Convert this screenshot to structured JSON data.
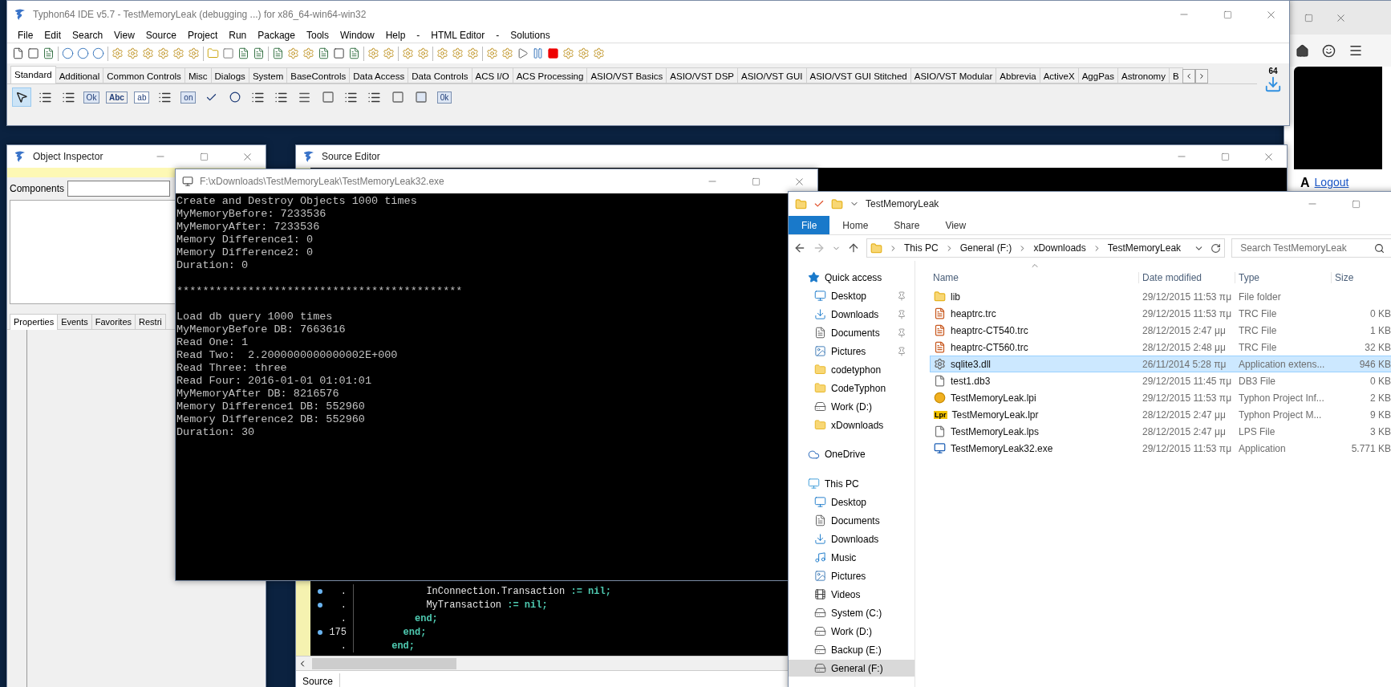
{
  "ide": {
    "title": "Typhon64 IDE v5.7 - TestMemoryLeak (debugging ...) for x86_64-win64-win32",
    "menu": [
      "File",
      "Edit",
      "Search",
      "View",
      "Source",
      "Project",
      "Run",
      "Package",
      "Tools",
      "Window",
      "Help",
      "-",
      "HTML Editor",
      "-",
      "Solutions"
    ],
    "palette_tabs": [
      {
        "label": "Standard",
        "selected": true
      },
      {
        "label": "Additional",
        "selected": false
      },
      {
        "label": "Common Controls",
        "selected": false
      },
      {
        "label": "Misc",
        "selected": false
      },
      {
        "label": "Dialogs",
        "selected": false
      },
      {
        "label": "System",
        "selected": false
      },
      {
        "label": "BaseControls",
        "selected": false
      },
      {
        "label": "Data Access",
        "selected": false
      },
      {
        "label": "Data Controls",
        "selected": false
      },
      {
        "label": "ACS I/O",
        "selected": false
      },
      {
        "label": "ACS Processing",
        "selected": false
      },
      {
        "label": "ASIO/VST Basics",
        "selected": false
      },
      {
        "label": "ASIO/VST DSP",
        "selected": false
      },
      {
        "label": "ASIO/VST GUI",
        "selected": false
      },
      {
        "label": "ASIO/VST GUI Stitched",
        "selected": false
      },
      {
        "label": "ASIO/VST Modular",
        "selected": false
      },
      {
        "label": "Abbrevia",
        "selected": false
      },
      {
        "label": "ActiveX",
        "selected": false
      },
      {
        "label": "AggPas",
        "selected": false
      },
      {
        "label": "Astronomy",
        "selected": false
      },
      {
        "label": "B",
        "selected": false
      }
    ],
    "platform_badge": "64",
    "components": [
      {
        "kind": "pointer",
        "selected": true
      },
      {
        "kind": "menu",
        "selected": false
      },
      {
        "kind": "popup",
        "selected": false
      },
      {
        "kind": "button",
        "text": "Ok",
        "selected": false
      },
      {
        "kind": "label",
        "text": "Abc",
        "selected": false
      },
      {
        "kind": "edit",
        "text": "ab",
        "selected": false
      },
      {
        "kind": "memo",
        "selected": false
      },
      {
        "kind": "button",
        "text": "on",
        "selected": false
      },
      {
        "kind": "checkbox",
        "selected": false
      },
      {
        "kind": "radio",
        "selected": false
      },
      {
        "kind": "list",
        "selected": false
      },
      {
        "kind": "list",
        "selected": false
      },
      {
        "kind": "scrollbar",
        "selected": false
      },
      {
        "kind": "panel",
        "selected": false
      },
      {
        "kind": "list",
        "selected": false
      },
      {
        "kind": "checklist",
        "selected": false
      },
      {
        "kind": "panel",
        "selected": false
      },
      {
        "kind": "frame",
        "selected": false
      },
      {
        "kind": "button",
        "text": "0k",
        "selected": false
      }
    ]
  },
  "browser": {
    "letter": "A",
    "link": "Logout"
  },
  "object_inspector": {
    "title": "Object Inspector",
    "components_label": "Components",
    "tabs": [
      {
        "label": "Properties",
        "selected": true
      },
      {
        "label": "Events",
        "selected": false
      },
      {
        "label": "Favorites",
        "selected": false
      },
      {
        "label": "Restri",
        "selected": false
      }
    ]
  },
  "source_editor": {
    "title": "Source Editor",
    "code_lines": [
      {
        "gutter": ".",
        "breakpoint": true,
        "parts": [
          {
            "text": "            InConnection.Transaction",
            "keyword": false
          },
          {
            "text": " := nil;",
            "keyword": true
          }
        ]
      },
      {
        "gutter": ".",
        "breakpoint": true,
        "parts": [
          {
            "text": "            MyTransaction",
            "keyword": false
          },
          {
            "text": " := nil;",
            "keyword": true
          }
        ]
      },
      {
        "gutter": ".",
        "breakpoint": false,
        "parts": [
          {
            "text": "          end;",
            "keyword": true
          }
        ]
      },
      {
        "gutter": "175",
        "breakpoint": true,
        "parts": [
          {
            "text": "        end;",
            "keyword": true
          }
        ]
      },
      {
        "gutter": ".",
        "breakpoint": false,
        "parts": [
          {
            "text": "      end;",
            "keyword": true
          }
        ]
      }
    ],
    "bottom_tab": "Source"
  },
  "console": {
    "title": "F:\\xDownloads\\TestMemoryLeak\\TestMemoryLeak32.exe",
    "sections": [
      {
        "lines": [
          "Create and Destroy Objects 1000 times",
          "MyMemoryBefore: 7233536",
          "MyMemoryAfter: 7233536",
          "Memory Difference1: 0",
          "Memory Difference2: 0",
          "Duration: 0"
        ]
      },
      {
        "lines": [
          "********************************************"
        ]
      },
      {
        "lines": [
          "Load db query 1000 times",
          "MyMemoryBefore DB: 7663616",
          "Read One: 1",
          "Read Two:  2.2000000000000002E+000",
          "Read Three: three",
          "Read Four: 2016-01-01 01:01:01",
          "MyMemoryAfter DB: 8216576",
          "Memory Difference1 DB: 552960",
          "Memory Difference2 DB: 552960",
          "Duration: 30"
        ]
      }
    ]
  },
  "explorer": {
    "title": "TestMemoryLeak",
    "ribbon_tabs": [
      {
        "label": "File",
        "selected": true
      },
      {
        "label": "Home",
        "selected": false
      },
      {
        "label": "Share",
        "selected": false
      },
      {
        "label": "View",
        "selected": false
      }
    ],
    "breadcrumb": [
      "This PC",
      "General (F:)",
      "xDownloads",
      "TestMemoryLeak"
    ],
    "search": {
      "placeholder": "Search TestMemoryLeak"
    },
    "nav": [
      {
        "label": "Quick access",
        "kind": "star",
        "selected": false,
        "children": [
          {
            "label": "Desktop",
            "kind": "desktop",
            "pinned": true,
            "selected": false
          },
          {
            "label": "Downloads",
            "kind": "download",
            "pinned": true,
            "selected": false
          },
          {
            "label": "Documents",
            "kind": "document",
            "pinned": true,
            "selected": false
          },
          {
            "label": "Pictures",
            "kind": "picture",
            "pinned": true,
            "selected": false
          },
          {
            "label": "codetyphon",
            "kind": "folder",
            "pinned": false,
            "selected": false
          },
          {
            "label": "CodeTyphon",
            "kind": "folder",
            "pinned": false,
            "selected": false
          },
          {
            "label": "Work (D:)",
            "kind": "drive",
            "pinned": false,
            "selected": false
          },
          {
            "label": "xDownloads",
            "kind": "folder",
            "pinned": false,
            "selected": false
          }
        ]
      },
      {
        "label": "OneDrive",
        "kind": "cloud",
        "selected": false
      },
      {
        "label": "This PC",
        "kind": "pc",
        "selected": false,
        "children": [
          {
            "label": "Desktop",
            "kind": "desktop",
            "selected": false
          },
          {
            "label": "Documents",
            "kind": "document",
            "selected": false
          },
          {
            "label": "Downloads",
            "kind": "download",
            "selected": false
          },
          {
            "label": "Music",
            "kind": "music",
            "selected": false
          },
          {
            "label": "Pictures",
            "kind": "picture",
            "selected": false
          },
          {
            "label": "Videos",
            "kind": "video",
            "selected": false
          },
          {
            "label": "System (C:)",
            "kind": "drive",
            "selected": false
          },
          {
            "label": "Work (D:)",
            "kind": "drive",
            "selected": false
          },
          {
            "label": "Backup (E:)",
            "kind": "drive",
            "selected": false
          },
          {
            "label": "General (F:)",
            "kind": "drive",
            "selected": true
          }
        ]
      }
    ],
    "columns": [
      "Name",
      "Date modified",
      "Type",
      "Size"
    ],
    "rows": [
      {
        "name": "lib",
        "date": "29/12/2015 11:53 πμ",
        "type": "File folder",
        "kind": "folder",
        "selected": false
      },
      {
        "name": "heaptrc.trc",
        "date": "29/12/2015 11:53 πμ",
        "type": "TRC File",
        "size": "0 KB",
        "kind": "trc",
        "selected": false
      },
      {
        "name": "heaptrc-CT540.trc",
        "date": "28/12/2015 2:47 μμ",
        "type": "TRC File",
        "size": "1 KB",
        "kind": "trc",
        "selected": false
      },
      {
        "name": "heaptrc-CT560.trc",
        "date": "28/12/2015 2:48 μμ",
        "type": "TRC File",
        "size": "32 KB",
        "kind": "trc",
        "selected": false
      },
      {
        "name": "sqlite3.dll",
        "date": "26/11/2014 5:28 πμ",
        "type": "Application extens...",
        "size": "946 KB",
        "kind": "dll",
        "selected": true
      },
      {
        "name": "test1.db3",
        "date": "29/12/2015 11:45 πμ",
        "type": "DB3 File",
        "size": "0 KB",
        "kind": "file",
        "selected": false
      },
      {
        "name": "TestMemoryLeak.lpi",
        "date": "29/12/2015 11:53 πμ",
        "type": "Typhon Project Inf...",
        "size": "2 KB",
        "kind": "lpi",
        "selected": false
      },
      {
        "name": "TestMemoryLeak.lpr",
        "date": "28/12/2015 2:47 μμ",
        "type": "Typhon Project M...",
        "size": "9 KB",
        "kind": "lpr",
        "icon_text": "Lpr",
        "selected": false
      },
      {
        "name": "TestMemoryLeak.lps",
        "date": "28/12/2015 2:47 μμ",
        "type": "LPS File",
        "size": "3 KB",
        "kind": "file",
        "selected": false
      },
      {
        "name": "TestMemoryLeak32.exe",
        "date": "29/12/2015 11:53 πμ",
        "type": "Application",
        "size": "5.771 KB",
        "kind": "exe",
        "selected": false
      }
    ]
  }
}
